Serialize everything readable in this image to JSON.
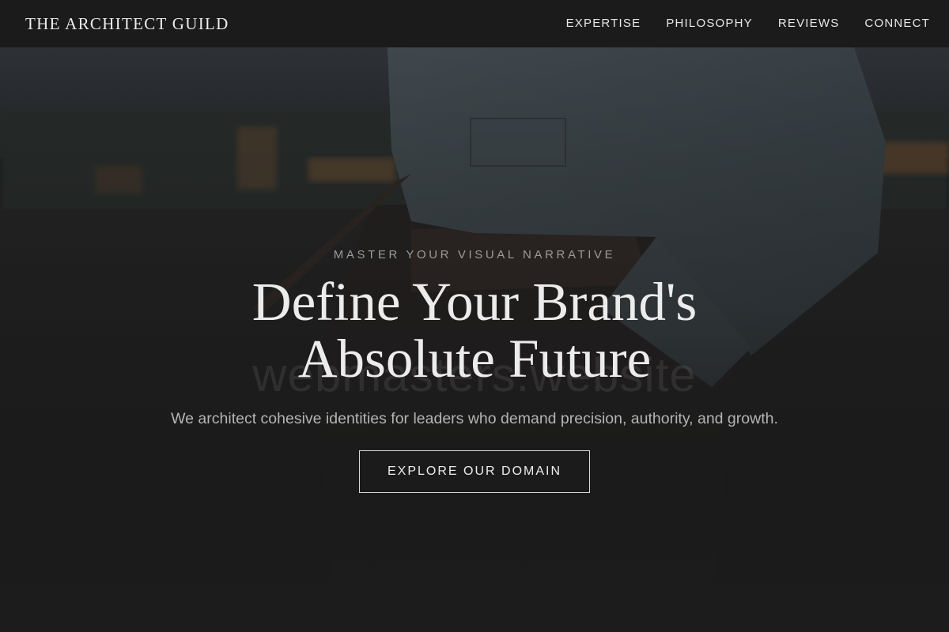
{
  "navbar": {
    "brand": "THE ARCHITECT GUILD",
    "links": [
      "EXPERTISE",
      "PHILOSOPHY",
      "REVIEWS",
      "CONNECT"
    ]
  },
  "hero": {
    "eyebrow": "MASTER YOUR VISUAL NARRATIVE",
    "headline_line1": "Define Your Brand's",
    "headline_line2": "Absolute Future",
    "subtext": "We architect cohesive identities for leaders who demand precision, authority, and growth.",
    "cta_label": "EXPLORE OUR DOMAIN",
    "watermark": "webmasters.website"
  },
  "colors": {
    "navbar_bg": "#1b1b1b",
    "page_bg": "#1c1c1c",
    "text_primary": "#ececec",
    "text_muted": "#9c9c9c",
    "button_border": "#d8d8d8"
  }
}
